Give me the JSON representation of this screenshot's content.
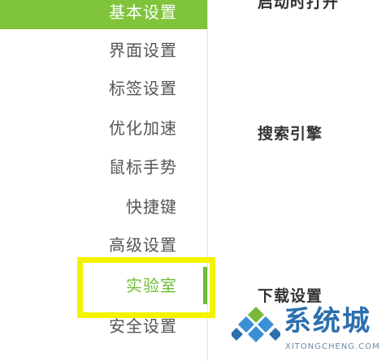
{
  "sidebar": {
    "items": [
      {
        "label": "基本设置"
      },
      {
        "label": "界面设置"
      },
      {
        "label": "标签设置"
      },
      {
        "label": "优化加速"
      },
      {
        "label": "鼠标手势"
      },
      {
        "label": "快捷键"
      },
      {
        "label": "高级设置"
      },
      {
        "label": "实验室"
      },
      {
        "label": "安全设置"
      }
    ]
  },
  "main": {
    "sections": [
      {
        "title": "启动时打开"
      },
      {
        "title": "搜索引擎"
      },
      {
        "title": "下载设置"
      }
    ]
  },
  "watermark": {
    "title": "系统城",
    "subtitle": "XITONGCHENG.COM"
  },
  "colors": {
    "accent_green": "#7fc43a",
    "active_text": "#6cbf35",
    "highlight_yellow": "#f5f200",
    "watermark_blue": "#2b6fae"
  }
}
